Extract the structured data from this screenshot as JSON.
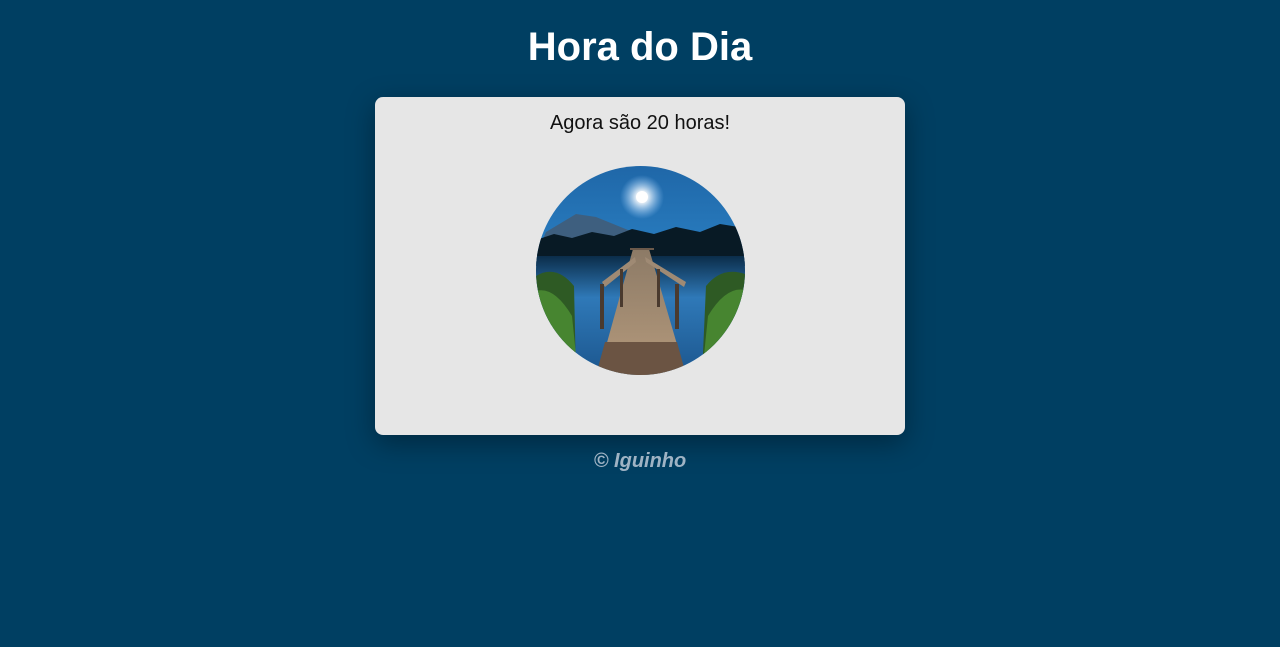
{
  "header": {
    "title": "Hora do Dia"
  },
  "card": {
    "message": "Agora são 20 horas!",
    "image": {
      "subject": "night-lake-pier-under-moon"
    }
  },
  "footer": {
    "credit": "© Iguinho"
  },
  "colors": {
    "background": "#003f62",
    "card_background": "#e6e6e6",
    "title_text": "#ffffff",
    "message_text": "#111111",
    "footer_text": "#9fb3c4"
  }
}
